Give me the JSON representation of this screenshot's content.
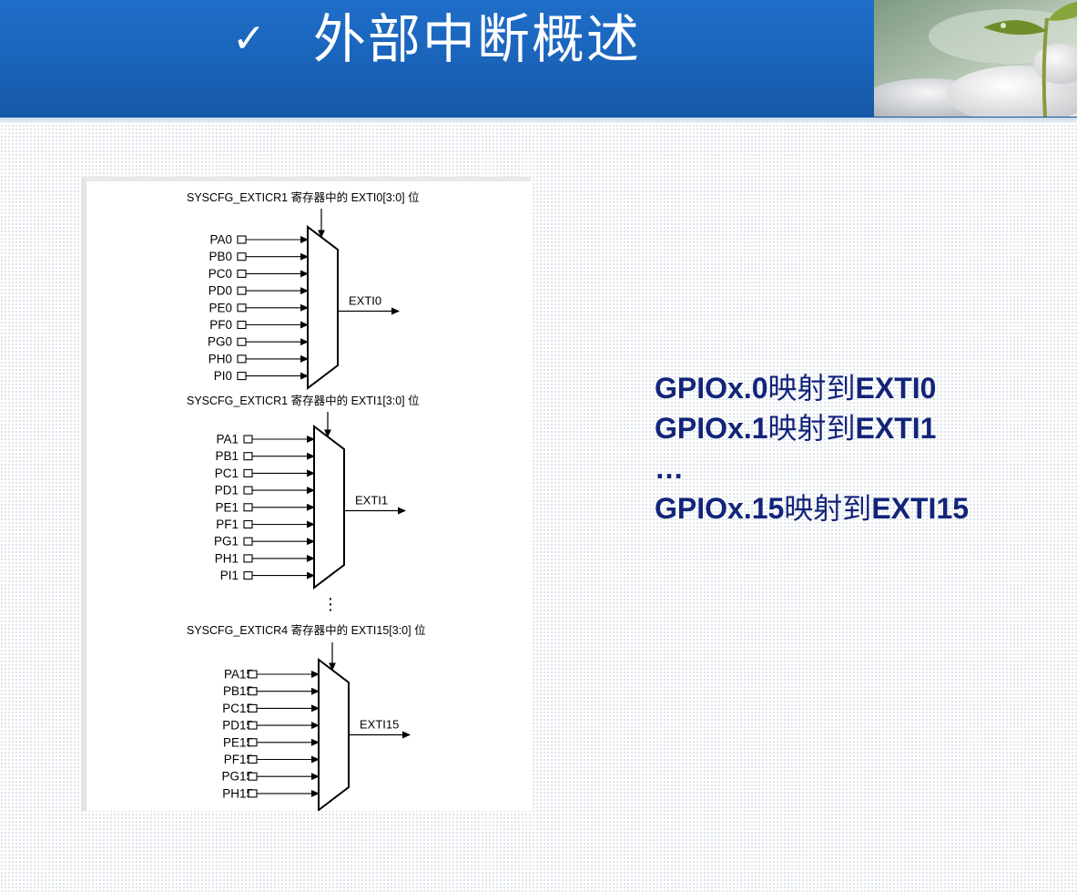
{
  "header": {
    "check_icon": "✓",
    "title": "外部中断概述"
  },
  "diagram": {
    "muxes": [
      {
        "caption": "SYSCFG_EXTICR1 寄存器中的 EXTI0[3:0] 位",
        "inputs": [
          "PA0",
          "PB0",
          "PC0",
          "PD0",
          "PE0",
          "PF0",
          "PG0",
          "PH0",
          "PI0"
        ],
        "output": "EXTI0"
      },
      {
        "caption": "SYSCFG_EXTICR1 寄存器中的 EXTI1[3:0] 位",
        "inputs": [
          "PA1",
          "PB1",
          "PC1",
          "PD1",
          "PE1",
          "PF1",
          "PG1",
          "PH1",
          "PI1"
        ],
        "output": "EXTI1"
      },
      {
        "caption": "SYSCFG_EXTICR4 寄存器中的 EXTI15[3:0] 位",
        "inputs": [
          "PA15",
          "PB15",
          "PC15",
          "PD15",
          "PE15",
          "PF15",
          "PG15",
          "PH15"
        ],
        "output": "EXTI15"
      }
    ],
    "continuation": "⋮"
  },
  "mapping": [
    {
      "source": "GPIOx.0",
      "verb": "映射到",
      "target": "EXTI0"
    },
    {
      "source": "GPIOx.1",
      "verb": "映射到",
      "target": "EXTI1"
    },
    {
      "ellipsis": "…"
    },
    {
      "source": "GPIOx.15",
      "verb": "映射到",
      "target": "EXTI15"
    }
  ]
}
